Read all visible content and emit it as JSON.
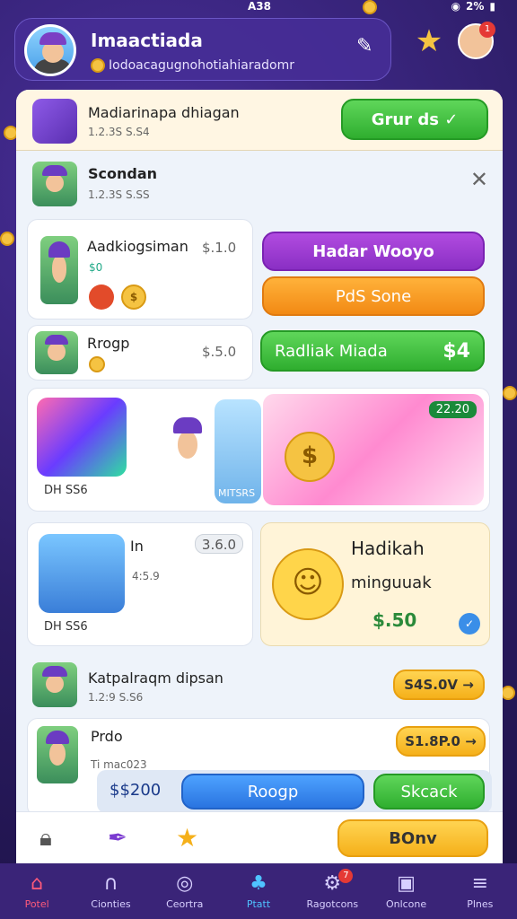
{
  "status": {
    "time": "A38",
    "battery": "2%"
  },
  "header": {
    "title": "Imaactiada",
    "subtitle": "Iodoacagugnohotiahiaradomr",
    "avatar_badge": "1"
  },
  "top_item": {
    "name": "Madiarinapa dhiagan",
    "meta": "1.2.3S S.S4",
    "button": "Grur ds ✓"
  },
  "section": {
    "name": "Scondan",
    "meta": "1.2.3S S.SS"
  },
  "card1": {
    "name": "Aadkiogsiman",
    "price": "$.1.0",
    "sub": "$0",
    "coin": "$",
    "btn_purple": "Hadar Wooyo",
    "btn_orange": "PdS Sone"
  },
  "card2": {
    "name": "Rrogp",
    "price": "$.5.0",
    "btn_green": "Radliak Miada",
    "btn_amount": "$4"
  },
  "promo_left": {
    "label": "DH SS6",
    "tag": "MITSRS"
  },
  "promo_right": {
    "tag": "22.20"
  },
  "card3": {
    "name": "In",
    "price": "3.6.0",
    "meta": "4:5.9",
    "label": "DH SS6"
  },
  "reward": {
    "title": "Hadikah",
    "sub": "minguuak",
    "amount": "$.50"
  },
  "item4": {
    "name": "Katpalraqm dipsan",
    "meta": "1.2:9 S.S6",
    "btn": "S4S.0V →"
  },
  "item5": {
    "name": "Prdo",
    "meta": "Ti mac023",
    "btn": "S1.8P.0 →"
  },
  "action_row": {
    "amount": "$$200",
    "btn_blue": "Roogp",
    "btn_green": "Skcack"
  },
  "bottom_btn": "BOnv",
  "nav": [
    "Potel",
    "Cionties",
    "Ceortra",
    "Ptatt",
    "Ragotcons",
    "Onlcone",
    "Plnes"
  ],
  "nav_badge": "7",
  "colors": {
    "accent": "#3a2478",
    "green": "#2fae2f",
    "purple": "#8a2fc4",
    "orange": "#f28a14"
  }
}
